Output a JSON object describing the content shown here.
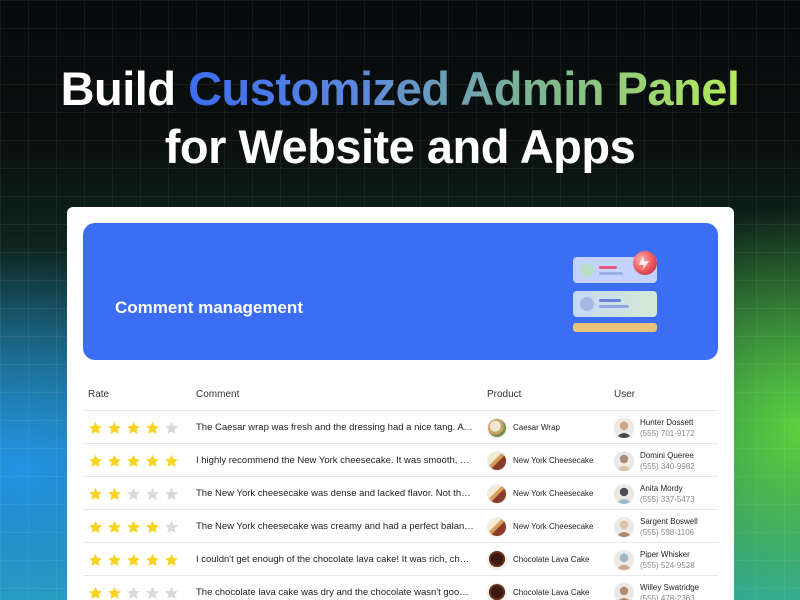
{
  "headline": {
    "line1_plain": "Build",
    "line1_gradient": "Customized Admin Panel",
    "line2": "for Website and Apps"
  },
  "banner": {
    "title": "Comment management"
  },
  "colors": {
    "banner": "#3b6ef5",
    "star_on": "#f7d21e",
    "star_off": "#d9d9d9",
    "gradient_start": "#3a6df2",
    "gradient_end": "#b6ec5a"
  },
  "table": {
    "columns": {
      "rate": "Rate",
      "comment": "Comment",
      "product": "Product",
      "user": "User"
    },
    "rows": [
      {
        "rating": 4,
        "comment": "The Caesar wrap was fresh and the dressing had a nice tang. A satisfying light meal.",
        "product": "Caesar Wrap",
        "product_icon": "caesar-wrap-thumb",
        "user_name": "Hunter Dossett",
        "user_phone": "(555) 701-9172"
      },
      {
        "rating": 5,
        "comment": "I highly recommend the New York cheesecake. It was smooth, creamy and rich.",
        "product": "New York Cheesecake",
        "product_icon": "cheesecake-thumb",
        "user_name": "Domini Queree",
        "user_phone": "(555) 340-9982"
      },
      {
        "rating": 2,
        "comment": "The New York cheesecake was dense and lacked flavor. Not the best I have had.",
        "product": "New York Cheesecake",
        "product_icon": "cheesecake-thumb",
        "user_name": "Anita Mordy",
        "user_phone": "(555) 337-5473"
      },
      {
        "rating": 4,
        "comment": "The New York cheesecake was creamy and had a perfect balance of sweetness.",
        "product": "New York Cheesecake",
        "product_icon": "cheesecake-thumb",
        "user_name": "Sargent Boswell",
        "user_phone": "(555) 598-1106"
      },
      {
        "rating": 5,
        "comment": "I couldn't get enough of the chocolate lava cake! It was rich, chocolatey and warm.",
        "product": "Chocolate Lava Cake",
        "product_icon": "lava-cake-thumb",
        "user_name": "Piper Whisker",
        "user_phone": "(555) 524-9528"
      },
      {
        "rating": 2,
        "comment": "The chocolate lava cake was dry and the chocolate wasn't gooey. Disappointing.",
        "product": "Chocolate Lava Cake",
        "product_icon": "lava-cake-thumb",
        "user_name": "Willey Swatridge",
        "user_phone": "(555) 478-2363"
      }
    ]
  }
}
